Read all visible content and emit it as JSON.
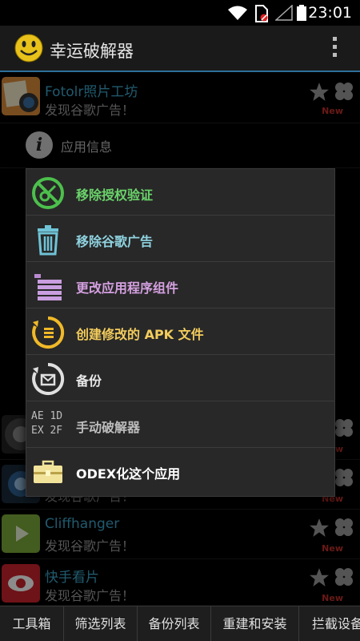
{
  "status_bar": {
    "time": "23:01"
  },
  "app_bar": {
    "title": "幸运破解器"
  },
  "apps": [
    {
      "name": "Fotolr照片工坊",
      "status": "发现谷歌广告！",
      "badge": "New"
    },
    {
      "name": "",
      "status": "",
      "badge": "New"
    },
    {
      "name": "",
      "status": "发现谷歌广告！",
      "badge": "New"
    },
    {
      "name": "Cliffhanger",
      "status": "发现谷歌广告！",
      "badge": "New"
    },
    {
      "name": "快手看片",
      "status": "发现谷歌广告！",
      "badge": "New"
    }
  ],
  "info_row": {
    "label": "应用信息"
  },
  "context_menu": {
    "items": [
      {
        "label": "移除授权验证",
        "color": "#6ad36a"
      },
      {
        "label": "移除谷歌广告",
        "color": "#8fd3e0"
      },
      {
        "label": "更改应用程序组件",
        "color": "#d4a0e0"
      },
      {
        "label": "创建修改的 APK 文件",
        "color": "#f3cc5c"
      },
      {
        "label": "备份",
        "color": "#e8e8e8"
      },
      {
        "label": "手动破解器",
        "color": "#bdbdbd",
        "icon_text_1": "AE 1D",
        "icon_text_2": "EX 2F"
      },
      {
        "label": "ODEX化这个应用",
        "color": "#ffffff"
      }
    ]
  },
  "tabs": [
    "工具箱",
    "筛选列表",
    "备份列表",
    "重建和安装",
    "拦截设备"
  ]
}
